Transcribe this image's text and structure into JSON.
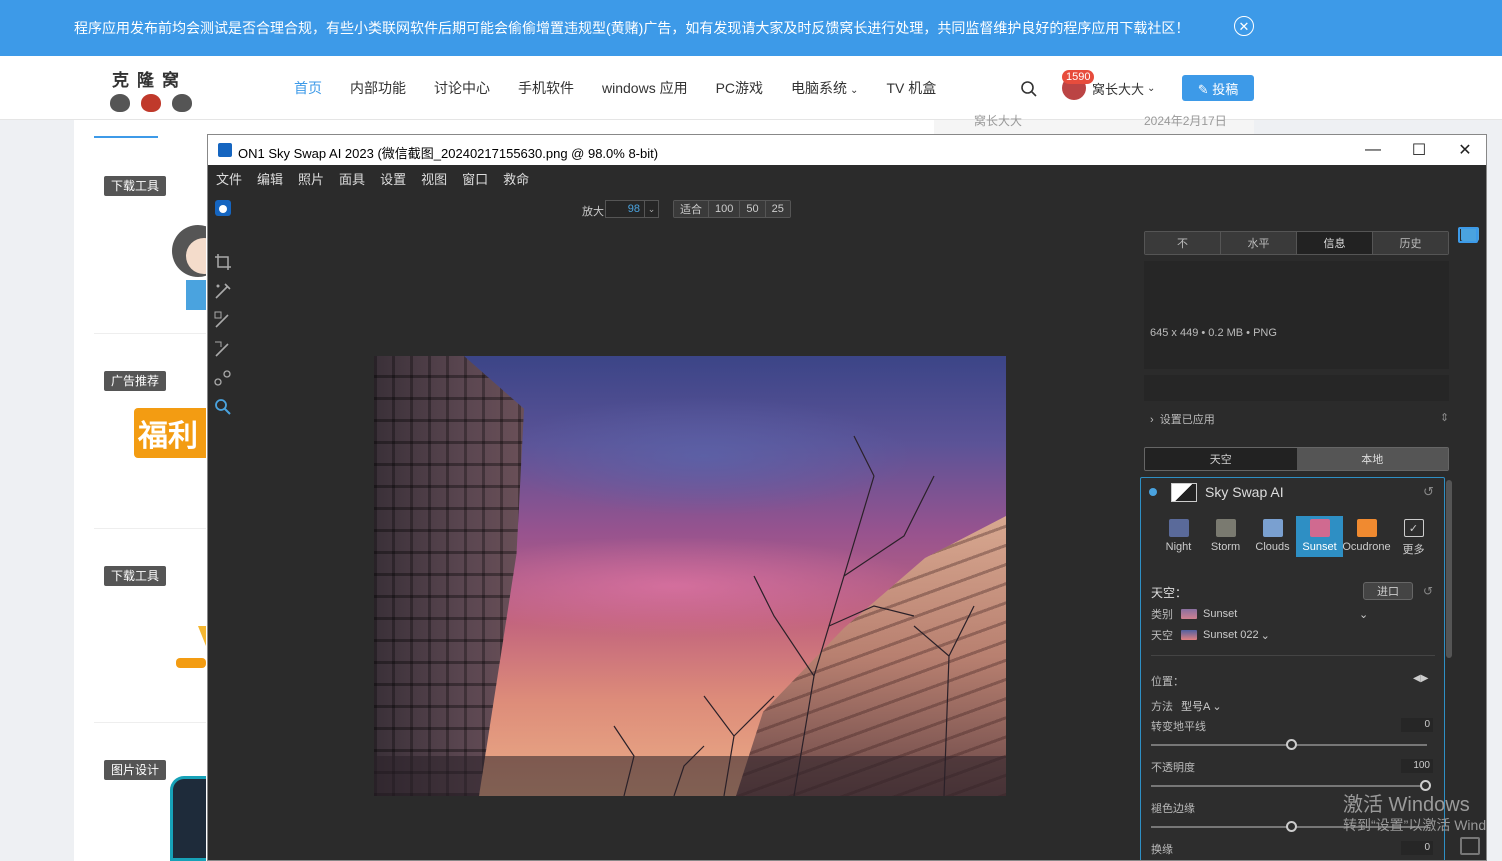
{
  "notice": {
    "text": "程序应用发布前均会测试是否合理合规，有些小类联网软件后期可能会偷偷增置违规型(黄赌)广告，如有发现请大家及时反馈窝长进行处理，共同监督维护良好的程序应用下载社区！",
    "close_icon": "close-icon"
  },
  "site": {
    "logo_text": "克隆窝",
    "nav": [
      {
        "label": "首页",
        "active": true
      },
      {
        "label": "内部功能"
      },
      {
        "label": "讨论中心"
      },
      {
        "label": "手机软件"
      },
      {
        "label": "windows 应用"
      },
      {
        "label": "PC游戏"
      },
      {
        "label": "电脑系统",
        "dropdown": true
      },
      {
        "label": "TV 机盒"
      }
    ],
    "search_icon": "search-icon",
    "notification_count": "1590",
    "username": "窝长大大",
    "post_button": "✎ 投稿",
    "behind_text_left": "窝长大大",
    "behind_text_right": "2024年2月17日"
  },
  "sidebar_tags": [
    "下载工具",
    "广告推荐",
    "下载工具",
    "图片设计"
  ],
  "fuli_text": "福利",
  "app": {
    "title": "ON1 Sky Swap AI 2023 (微信截图_20240217155630.png @ 98.0% 8-bit)",
    "menu": [
      "文件",
      "编辑",
      "照片",
      "面具",
      "设置",
      "视图",
      "窗口",
      "救命"
    ],
    "zoom_label": "放大",
    "zoom_value": "98",
    "zoom_buttons": [
      "适合",
      "100",
      "50",
      "25"
    ],
    "panel": {
      "tabs": [
        "不",
        "水平",
        "信息",
        "历史"
      ],
      "active_tab": "信息",
      "info": "645 x 449 • 0.2 MB • PNG",
      "settings_applied": "设置已应用",
      "mode_tabs": [
        "天空",
        "本地"
      ],
      "module_name": "Sky Swap AI",
      "presets": [
        {
          "label": "Night",
          "color": "#5a6a9a"
        },
        {
          "label": "Storm",
          "color": "#7a7a70"
        },
        {
          "label": "Clouds",
          "color": "#7aa0d0"
        },
        {
          "label": "Sunset",
          "color": "#d06a90",
          "active": true
        },
        {
          "label": "Ocudrone",
          "color": "#f08a30"
        },
        {
          "label": "更多",
          "color": "#444444"
        }
      ],
      "sky_label": "天空：",
      "import_label": "进口",
      "category_label": "类别",
      "category_value": "Sunset",
      "sky_row_label": "天空",
      "sky_value": "Sunset 022",
      "position_label": "位置：",
      "method_label": "方法",
      "method_value": "型号A",
      "horizon_label": "转变地平线",
      "horizon_value": "0",
      "opacity_label": "不透明度",
      "opacity_value": "100",
      "fade_label": "褪色边缘",
      "swap_label": "换缘",
      "swap_value": "0"
    }
  },
  "watermark": {
    "line1": "激活 Windows",
    "line2": "转到“设置”以激活 Wind"
  }
}
